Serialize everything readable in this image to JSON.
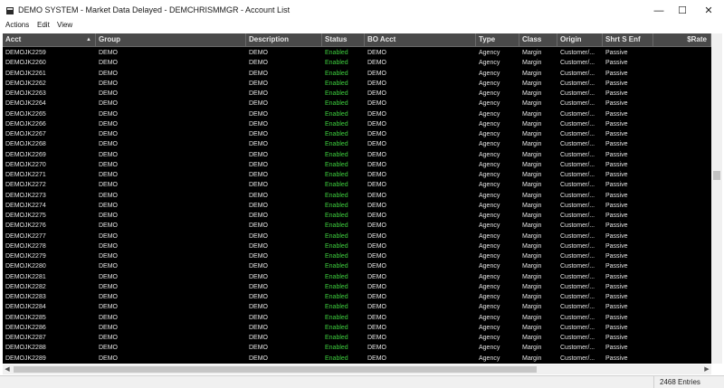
{
  "window": {
    "title": "DEMO SYSTEM - Market Data Delayed - DEMCHRISMMGR - Account List",
    "controls": {
      "minimize": "—",
      "maximize": "☐",
      "close": "✕"
    },
    "icon": "app-window-icon"
  },
  "menu": [
    "Actions",
    "Edit",
    "View"
  ],
  "columns": [
    "Acct",
    "Group",
    "Description",
    "Status",
    "BO Acct",
    "Type",
    "Class",
    "Origin",
    "Shrt S Enf",
    "$Rate"
  ],
  "sort_indicator": "▲",
  "rows": [
    {
      "acct": "DEMOJK2259",
      "group": "DEMO",
      "description": "DEMO",
      "status": "Enabled",
      "bo_acct": "DEMO",
      "type": "Agency",
      "class": "Margin",
      "origin": "Customer/...",
      "shrt": "Passive"
    },
    {
      "acct": "DEMOJK2260",
      "group": "DEMO",
      "description": "DEMO",
      "status": "Enabled",
      "bo_acct": "DEMO",
      "type": "Agency",
      "class": "Margin",
      "origin": "Customer/...",
      "shrt": "Passive"
    },
    {
      "acct": "DEMOJK2261",
      "group": "DEMO",
      "description": "DEMO",
      "status": "Enabled",
      "bo_acct": "DEMO",
      "type": "Agency",
      "class": "Margin",
      "origin": "Customer/...",
      "shrt": "Passive"
    },
    {
      "acct": "DEMOJK2262",
      "group": "DEMO",
      "description": "DEMO",
      "status": "Enabled",
      "bo_acct": "DEMO",
      "type": "Agency",
      "class": "Margin",
      "origin": "Customer/...",
      "shrt": "Passive"
    },
    {
      "acct": "DEMOJK2263",
      "group": "DEMO",
      "description": "DEMO",
      "status": "Enabled",
      "bo_acct": "DEMO",
      "type": "Agency",
      "class": "Margin",
      "origin": "Customer/...",
      "shrt": "Passive"
    },
    {
      "acct": "DEMOJK2264",
      "group": "DEMO",
      "description": "DEMO",
      "status": "Enabled",
      "bo_acct": "DEMO",
      "type": "Agency",
      "class": "Margin",
      "origin": "Customer/...",
      "shrt": "Passive"
    },
    {
      "acct": "DEMOJK2265",
      "group": "DEMO",
      "description": "DEMO",
      "status": "Enabled",
      "bo_acct": "DEMO",
      "type": "Agency",
      "class": "Margin",
      "origin": "Customer/...",
      "shrt": "Passive"
    },
    {
      "acct": "DEMOJK2266",
      "group": "DEMO",
      "description": "DEMO",
      "status": "Enabled",
      "bo_acct": "DEMO",
      "type": "Agency",
      "class": "Margin",
      "origin": "Customer/...",
      "shrt": "Passive"
    },
    {
      "acct": "DEMOJK2267",
      "group": "DEMO",
      "description": "DEMO",
      "status": "Enabled",
      "bo_acct": "DEMO",
      "type": "Agency",
      "class": "Margin",
      "origin": "Customer/...",
      "shrt": "Passive"
    },
    {
      "acct": "DEMOJK2268",
      "group": "DEMO",
      "description": "DEMO",
      "status": "Enabled",
      "bo_acct": "DEMO",
      "type": "Agency",
      "class": "Margin",
      "origin": "Customer/...",
      "shrt": "Passive"
    },
    {
      "acct": "DEMOJK2269",
      "group": "DEMO",
      "description": "DEMO",
      "status": "Enabled",
      "bo_acct": "DEMO",
      "type": "Agency",
      "class": "Margin",
      "origin": "Customer/...",
      "shrt": "Passive"
    },
    {
      "acct": "DEMOJK2270",
      "group": "DEMO",
      "description": "DEMO",
      "status": "Enabled",
      "bo_acct": "DEMO",
      "type": "Agency",
      "class": "Margin",
      "origin": "Customer/...",
      "shrt": "Passive"
    },
    {
      "acct": "DEMOJK2271",
      "group": "DEMO",
      "description": "DEMO",
      "status": "Enabled",
      "bo_acct": "DEMO",
      "type": "Agency",
      "class": "Margin",
      "origin": "Customer/...",
      "shrt": "Passive"
    },
    {
      "acct": "DEMOJK2272",
      "group": "DEMO",
      "description": "DEMO",
      "status": "Enabled",
      "bo_acct": "DEMO",
      "type": "Agency",
      "class": "Margin",
      "origin": "Customer/...",
      "shrt": "Passive"
    },
    {
      "acct": "DEMOJK2273",
      "group": "DEMO",
      "description": "DEMO",
      "status": "Enabled",
      "bo_acct": "DEMO",
      "type": "Agency",
      "class": "Margin",
      "origin": "Customer/...",
      "shrt": "Passive"
    },
    {
      "acct": "DEMOJK2274",
      "group": "DEMO",
      "description": "DEMO",
      "status": "Enabled",
      "bo_acct": "DEMO",
      "type": "Agency",
      "class": "Margin",
      "origin": "Customer/...",
      "shrt": "Passive"
    },
    {
      "acct": "DEMOJK2275",
      "group": "DEMO",
      "description": "DEMO",
      "status": "Enabled",
      "bo_acct": "DEMO",
      "type": "Agency",
      "class": "Margin",
      "origin": "Customer/...",
      "shrt": "Passive"
    },
    {
      "acct": "DEMOJK2276",
      "group": "DEMO",
      "description": "DEMO",
      "status": "Enabled",
      "bo_acct": "DEMO",
      "type": "Agency",
      "class": "Margin",
      "origin": "Customer/...",
      "shrt": "Passive"
    },
    {
      "acct": "DEMOJK2277",
      "group": "DEMO",
      "description": "DEMO",
      "status": "Enabled",
      "bo_acct": "DEMO",
      "type": "Agency",
      "class": "Margin",
      "origin": "Customer/...",
      "shrt": "Passive"
    },
    {
      "acct": "DEMOJK2278",
      "group": "DEMO",
      "description": "DEMO",
      "status": "Enabled",
      "bo_acct": "DEMO",
      "type": "Agency",
      "class": "Margin",
      "origin": "Customer/...",
      "shrt": "Passive"
    },
    {
      "acct": "DEMOJK2279",
      "group": "DEMO",
      "description": "DEMO",
      "status": "Enabled",
      "bo_acct": "DEMO",
      "type": "Agency",
      "class": "Margin",
      "origin": "Customer/...",
      "shrt": "Passive"
    },
    {
      "acct": "DEMOJK2280",
      "group": "DEMO",
      "description": "DEMO",
      "status": "Enabled",
      "bo_acct": "DEMO",
      "type": "Agency",
      "class": "Margin",
      "origin": "Customer/...",
      "shrt": "Passive"
    },
    {
      "acct": "DEMOJK2281",
      "group": "DEMO",
      "description": "DEMO",
      "status": "Enabled",
      "bo_acct": "DEMO",
      "type": "Agency",
      "class": "Margin",
      "origin": "Customer/...",
      "shrt": "Passive"
    },
    {
      "acct": "DEMOJK2282",
      "group": "DEMO",
      "description": "DEMO",
      "status": "Enabled",
      "bo_acct": "DEMO",
      "type": "Agency",
      "class": "Margin",
      "origin": "Customer/...",
      "shrt": "Passive"
    },
    {
      "acct": "DEMOJK2283",
      "group": "DEMO",
      "description": "DEMO",
      "status": "Enabled",
      "bo_acct": "DEMO",
      "type": "Agency",
      "class": "Margin",
      "origin": "Customer/...",
      "shrt": "Passive"
    },
    {
      "acct": "DEMOJK2284",
      "group": "DEMO",
      "description": "DEMO",
      "status": "Enabled",
      "bo_acct": "DEMO",
      "type": "Agency",
      "class": "Margin",
      "origin": "Customer/...",
      "shrt": "Passive"
    },
    {
      "acct": "DEMOJK2285",
      "group": "DEMO",
      "description": "DEMO",
      "status": "Enabled",
      "bo_acct": "DEMO",
      "type": "Agency",
      "class": "Margin",
      "origin": "Customer/...",
      "shrt": "Passive"
    },
    {
      "acct": "DEMOJK2286",
      "group": "DEMO",
      "description": "DEMO",
      "status": "Enabled",
      "bo_acct": "DEMO",
      "type": "Agency",
      "class": "Margin",
      "origin": "Customer/...",
      "shrt": "Passive"
    },
    {
      "acct": "DEMOJK2287",
      "group": "DEMO",
      "description": "DEMO",
      "status": "Enabled",
      "bo_acct": "DEMO",
      "type": "Agency",
      "class": "Margin",
      "origin": "Customer/...",
      "shrt": "Passive"
    },
    {
      "acct": "DEMOJK2288",
      "group": "DEMO",
      "description": "DEMO",
      "status": "Enabled",
      "bo_acct": "DEMO",
      "type": "Agency",
      "class": "Margin",
      "origin": "Customer/...",
      "shrt": "Passive"
    },
    {
      "acct": "DEMOJK2289",
      "group": "DEMO",
      "description": "DEMO",
      "status": "Enabled",
      "bo_acct": "DEMO",
      "type": "Agency",
      "class": "Margin",
      "origin": "Customer/...",
      "shrt": "Passive"
    }
  ],
  "status_bar": {
    "entries": "2468 Entries"
  },
  "colors": {
    "grid_bg": "#000000",
    "header_bg": "#4a4a4a",
    "text": "#e6e6e6",
    "status_enabled": "#3ecf3e"
  }
}
